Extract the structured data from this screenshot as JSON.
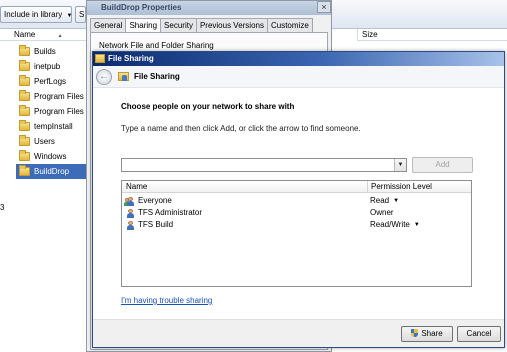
{
  "explorer": {
    "toolbar": {
      "include_in_library": "Include in library",
      "share_partial": "S"
    },
    "columns": {
      "name": "Name",
      "size": "Size"
    },
    "folders": [
      {
        "label": "Builds"
      },
      {
        "label": "inetpub"
      },
      {
        "label": "PerfLogs"
      },
      {
        "label": "Program Files"
      },
      {
        "label": "Program Files (x"
      },
      {
        "label": "tempInstall"
      },
      {
        "label": "Users"
      },
      {
        "label": "Windows"
      },
      {
        "label": "BuildDrop",
        "selected": true
      }
    ],
    "edge_text": "3"
  },
  "properties": {
    "title": "BuildDrop Properties",
    "tabs": [
      {
        "label": "General"
      },
      {
        "label": "Sharing",
        "active": true
      },
      {
        "label": "Security"
      },
      {
        "label": "Previous Versions"
      },
      {
        "label": "Customize"
      }
    ],
    "group_label": "Network File and Folder Sharing"
  },
  "file_sharing": {
    "window_title": "File Sharing",
    "nav_title": "File Sharing",
    "heading": "Choose people on your network to share with",
    "instruction": "Type a name and then click Add, or click the arrow to find someone.",
    "name_input": {
      "value": "",
      "placeholder": ""
    },
    "add_label": "Add",
    "list_headers": {
      "name": "Name",
      "permission": "Permission Level"
    },
    "entries": [
      {
        "name": "Everyone",
        "permission": "Read",
        "has_dropdown": true,
        "icon": "group-icon"
      },
      {
        "name": "TFS Administrator",
        "permission": "Owner",
        "has_dropdown": false,
        "icon": "user-icon"
      },
      {
        "name": "TFS Build",
        "permission": "Read/Write",
        "has_dropdown": true,
        "icon": "user-icon"
      }
    ],
    "trouble_link": "I'm having trouble sharing",
    "share_label": "Share",
    "cancel_label": "Cancel"
  },
  "colors": {
    "title_bar_start": "#0a2a6e",
    "title_bar_end": "#a7c2ea",
    "selection": "#3d6bb8",
    "link": "#1a4fb8"
  }
}
